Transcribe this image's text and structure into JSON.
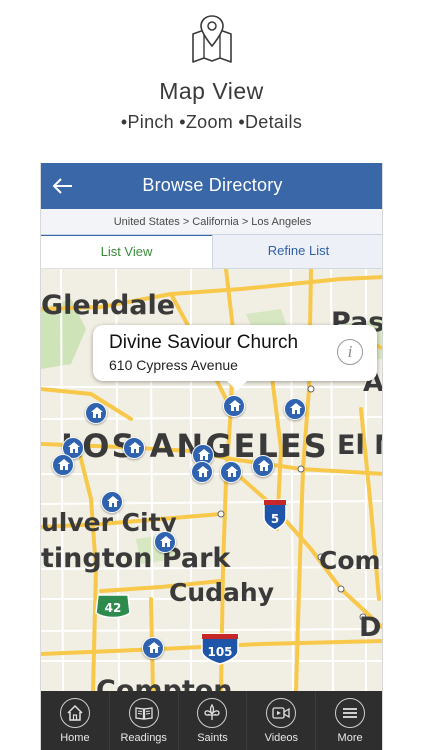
{
  "promo": {
    "title": "Map View",
    "subtitle": "•Pinch •Zoom •Details",
    "icon": "map-pin-icon"
  },
  "navbar": {
    "title": "Browse Directory",
    "back_icon": "back-arrow-icon"
  },
  "breadcrumb": "United States > California > Los Angeles",
  "tabs": {
    "list_view": "List View",
    "refine_list": "Refine List"
  },
  "callout": {
    "name": "Divine Saviour Church",
    "address": "610 Cypress Avenue",
    "info_glyph": "i"
  },
  "map_labels": {
    "glendale": "Glendale",
    "los_angeles": "LOS ANGELES",
    "culver_city": "ulver City",
    "huntington_park": "tington Park",
    "cudahy": "Cudahy",
    "compton": "Compton",
    "pasadena_fragment": "Pas",
    "alhambra_fragment": "A",
    "el_monte_fragment": "El M",
    "commerce_fragment": "Com",
    "downey_fragment": "D",
    "route_5": "5",
    "route_42": "42",
    "route_105": "105"
  },
  "colors": {
    "navbar": "#3a67a8",
    "pin": "#2f63b0",
    "tabbar": "#2e2e2e",
    "map_road": "#f7c84a",
    "map_bg": "#f1eee3",
    "list_tab_text": "#3a8a3a"
  },
  "tabbar": [
    {
      "label": "Home",
      "icon": "home-icon"
    },
    {
      "label": "Readings",
      "icon": "book-icon"
    },
    {
      "label": "Saints",
      "icon": "fleur-de-lis-icon"
    },
    {
      "label": "Videos",
      "icon": "video-icon"
    },
    {
      "label": "More",
      "icon": "menu-icon"
    }
  ]
}
